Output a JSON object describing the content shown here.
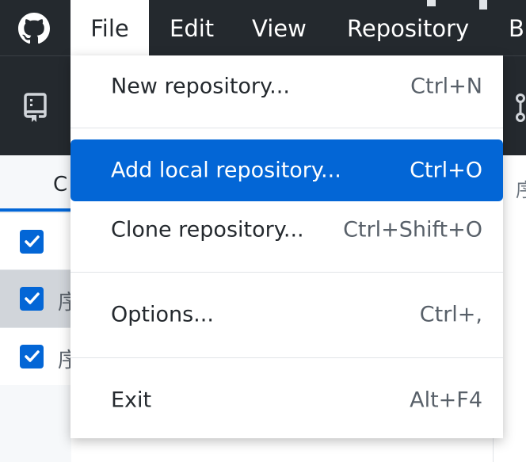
{
  "menubar": {
    "logo_icon": "github-octocat-icon",
    "items": [
      {
        "label": "File"
      },
      {
        "label": "Edit"
      },
      {
        "label": "View"
      },
      {
        "label": "Repository"
      },
      {
        "label": "Br"
      }
    ],
    "active": "File"
  },
  "toolbar": {
    "repo_icon": "repository-icon",
    "branch_icon": "branch-icon"
  },
  "main": {
    "tab_label": "C",
    "right_tab_label": "序",
    "rows": [
      {
        "checked": true,
        "text": ""
      },
      {
        "checked": true,
        "text": "序"
      },
      {
        "checked": true,
        "text": "序"
      }
    ]
  },
  "file_menu": {
    "items": [
      {
        "label": "New repository...",
        "shortcut": "Ctrl+N"
      },
      {
        "label": "Add local repository...",
        "shortcut": "Ctrl+O"
      },
      {
        "label": "Clone repository...",
        "shortcut": "Ctrl+Shift+O"
      },
      {
        "label": "Options...",
        "shortcut": "Ctrl+,"
      },
      {
        "label": "Exit",
        "shortcut": "Alt+F4"
      }
    ],
    "highlighted": "Add local repository..."
  },
  "colors": {
    "accent": "#0366d6",
    "menubar_bg": "#24292e",
    "text": "#24292e"
  }
}
